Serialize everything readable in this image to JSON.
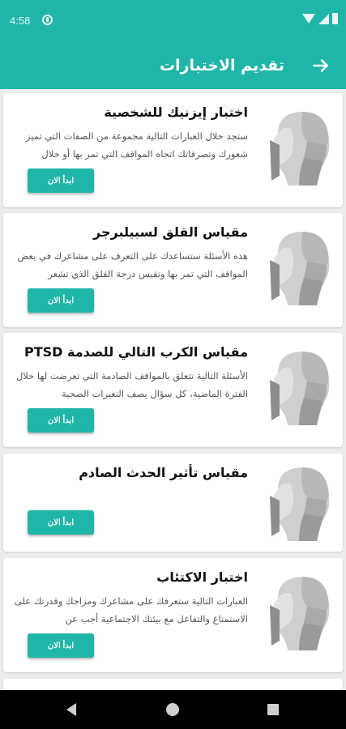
{
  "status_bar": {
    "time": "4:58"
  },
  "app_bar": {
    "title": "تقديم الاختبارات"
  },
  "colors": {
    "accent": "#1fb5a8",
    "background": "#ececec",
    "card": "#ffffff"
  },
  "icons": {
    "back": "arrow-forward-icon",
    "test": "head-profile-icon"
  },
  "tests": [
    {
      "title": "اختبار إيزنيك للشخصية",
      "description": "ستجد خلال العبارات التالية مجموعة من الصفات التي تميز شعورك وتصرفاتك اتجاه المواقف التي تمر بها أو خلال",
      "button": "ابدأ الان"
    },
    {
      "title": "مقياس القلق لسبيلبرجر",
      "description": "هذه الأسئلة ستساعدك على التعرف على مشاعرك في بعض المواقف التي تمر بها وتقيس درجة القلق الذي تشعر",
      "button": "ابدأ الان"
    },
    {
      "title": "مقياس الكرب التالي للصدمة PTSD",
      "description": "الأسئلة التالية تتعلق بالمواقف الصادمة التي تعرضت لها خلال الفترة الماضية، كل سؤال يصف التغيرات الصحية",
      "button": "ابدأ الان"
    },
    {
      "title": "مقياس تأثير الحدث الصادم",
      "description": "",
      "button": "ابدأ الان"
    },
    {
      "title": "اختبار الاكتئاب",
      "description": "العبارات التالية ستعرفك على مشاعرك ومزاجك وقدرتك على الاستمتاع والتفاعل مع بيئتك الاجتماعية أجب عن",
      "button": "ابدأ الان"
    }
  ]
}
